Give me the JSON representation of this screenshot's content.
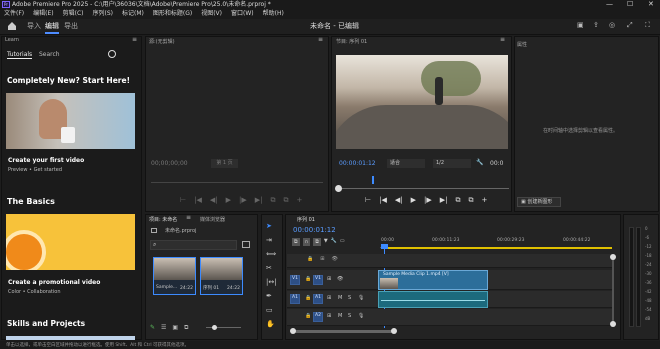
{
  "app": {
    "title": "Adobe Premiere Pro 2025 - C:\\用户\\36036\\文档\\Adobe\\Premiere Pro\\25.0\\未命名.prproj *",
    "win_min": "—",
    "win_max": "☐",
    "win_close": "✕"
  },
  "menu": [
    "文件(F)",
    "编辑(E)",
    "剪辑(C)",
    "序列(S)",
    "标记(M)",
    "图形和标题(G)",
    "视图(V)",
    "窗口(W)",
    "帮助(H)"
  ],
  "workspace": {
    "tabs": [
      "导入",
      "编辑",
      "导出"
    ],
    "active": "编辑",
    "center": "未命名 - 已编辑"
  },
  "learn": {
    "header": "Learn",
    "tabs": [
      "Tutorials",
      "Search"
    ],
    "hero_title": "Completely New? Start Here!",
    "card1_title": "Create your first video",
    "card1_sub": "Preview • Get started",
    "section2": "The Basics",
    "card2_title": "Create a promotional video",
    "card2_sub": "Color • Collaboration",
    "section3": "Skills and Projects"
  },
  "source": {
    "header": "源:(无剪辑)",
    "timecode": "00;00;00;00",
    "page": "第 1 页"
  },
  "program": {
    "header": "节目: 序列 01",
    "timecode": "00:00:01:12",
    "fit": "适合",
    "ratio": "1/2",
    "end_tc": "00:0"
  },
  "props": {
    "header": "属性",
    "message": "在时间轴中选择剪辑以查看属性。",
    "button": "创建新图形"
  },
  "project": {
    "tab1": "项目: 未命名",
    "tab2": "媒体浏览器",
    "file": "未命名.prproj",
    "items": [
      {
        "name": "Sample...",
        "dur": "24:22"
      },
      {
        "name": "序列 01",
        "dur": "24:22"
      }
    ]
  },
  "timeline": {
    "tab": "序列 01",
    "timecode": "00:00:01:12",
    "ruler": [
      "00:00",
      "00:00:11:23",
      "00:00:29:23",
      "00:00:44:22"
    ],
    "v1": "V1",
    "a1": "A1",
    "a2": "A2",
    "clip": "Sample Media Clip 1.mp4 [V]",
    "mute": "M",
    "solo": "S"
  },
  "meter": {
    "levels": [
      "0",
      "-6",
      "-12",
      "-18",
      "-24",
      "-30",
      "-36",
      "-42",
      "-48",
      "-54",
      "dB"
    ]
  },
  "status": "单击以选择，或单击空白区域并拖动以进行框选。使用 Shift、Alt 和 Ctrl 可获得其他选项。"
}
